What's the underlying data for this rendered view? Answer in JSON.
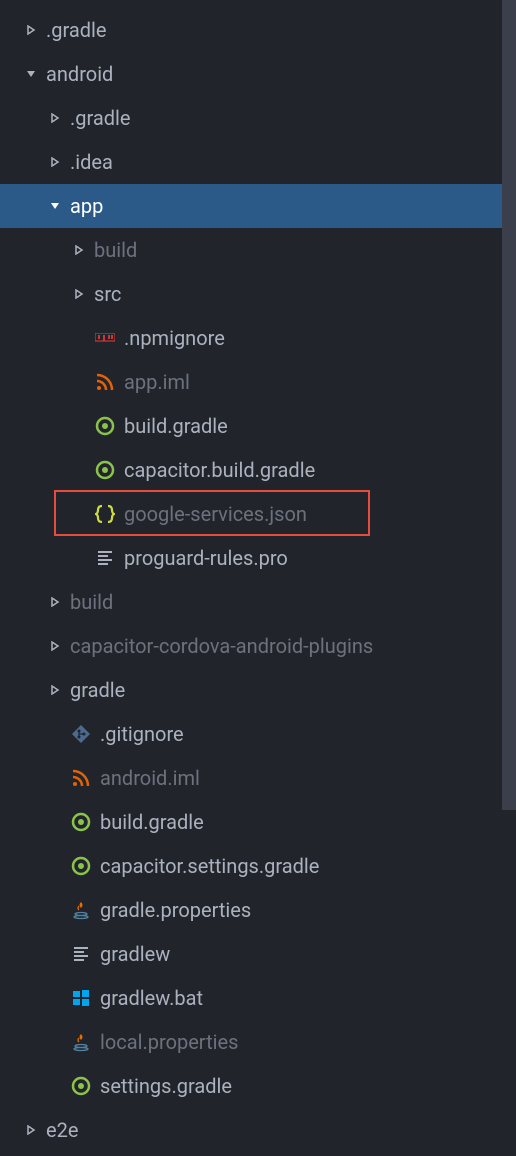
{
  "tree": {
    "items": [
      {
        "depth": 0,
        "chevron": "right",
        "icon": null,
        "label": ".gradle",
        "dimmed": false,
        "selected": false,
        "highlight": false
      },
      {
        "depth": 0,
        "chevron": "down",
        "icon": null,
        "label": "android",
        "dimmed": false,
        "selected": false,
        "highlight": false
      },
      {
        "depth": 1,
        "chevron": "right",
        "icon": null,
        "label": ".gradle",
        "dimmed": false,
        "selected": false,
        "highlight": false
      },
      {
        "depth": 1,
        "chevron": "right",
        "icon": null,
        "label": ".idea",
        "dimmed": false,
        "selected": false,
        "highlight": false
      },
      {
        "depth": 1,
        "chevron": "down",
        "icon": null,
        "label": "app",
        "dimmed": false,
        "selected": true,
        "highlight": false
      },
      {
        "depth": 2,
        "chevron": "right",
        "icon": null,
        "label": "build",
        "dimmed": true,
        "selected": false,
        "highlight": false
      },
      {
        "depth": 2,
        "chevron": "right",
        "icon": null,
        "label": "src",
        "dimmed": false,
        "selected": false,
        "highlight": false
      },
      {
        "depth": 2,
        "chevron": null,
        "icon": "npm",
        "label": ".npmignore",
        "dimmed": false,
        "selected": false,
        "highlight": false
      },
      {
        "depth": 2,
        "chevron": null,
        "icon": "rss",
        "label": "app.iml",
        "dimmed": true,
        "selected": false,
        "highlight": false
      },
      {
        "depth": 2,
        "chevron": null,
        "icon": "gradle",
        "label": "build.gradle",
        "dimmed": false,
        "selected": false,
        "highlight": false
      },
      {
        "depth": 2,
        "chevron": null,
        "icon": "gradle",
        "label": "capacitor.build.gradle",
        "dimmed": false,
        "selected": false,
        "highlight": false
      },
      {
        "depth": 2,
        "chevron": null,
        "icon": "json",
        "label": "google-services.json",
        "dimmed": true,
        "selected": false,
        "highlight": true
      },
      {
        "depth": 2,
        "chevron": null,
        "icon": "lines",
        "label": "proguard-rules.pro",
        "dimmed": false,
        "selected": false,
        "highlight": false
      },
      {
        "depth": 1,
        "chevron": "right",
        "icon": null,
        "label": "build",
        "dimmed": true,
        "selected": false,
        "highlight": false
      },
      {
        "depth": 1,
        "chevron": "right",
        "icon": null,
        "label": "capacitor-cordova-android-plugins",
        "dimmed": true,
        "selected": false,
        "highlight": false
      },
      {
        "depth": 1,
        "chevron": "right",
        "icon": null,
        "label": "gradle",
        "dimmed": false,
        "selected": false,
        "highlight": false
      },
      {
        "depth": 1,
        "chevron": null,
        "icon": "git",
        "label": ".gitignore",
        "dimmed": false,
        "selected": false,
        "highlight": false
      },
      {
        "depth": 1,
        "chevron": null,
        "icon": "rss",
        "label": "android.iml",
        "dimmed": true,
        "selected": false,
        "highlight": false
      },
      {
        "depth": 1,
        "chevron": null,
        "icon": "gradle",
        "label": "build.gradle",
        "dimmed": false,
        "selected": false,
        "highlight": false
      },
      {
        "depth": 1,
        "chevron": null,
        "icon": "gradle",
        "label": "capacitor.settings.gradle",
        "dimmed": false,
        "selected": false,
        "highlight": false
      },
      {
        "depth": 1,
        "chevron": null,
        "icon": "java",
        "label": "gradle.properties",
        "dimmed": false,
        "selected": false,
        "highlight": false
      },
      {
        "depth": 1,
        "chevron": null,
        "icon": "lines",
        "label": "gradlew",
        "dimmed": false,
        "selected": false,
        "highlight": false
      },
      {
        "depth": 1,
        "chevron": null,
        "icon": "windows",
        "label": "gradlew.bat",
        "dimmed": false,
        "selected": false,
        "highlight": false
      },
      {
        "depth": 1,
        "chevron": null,
        "icon": "java",
        "label": "local.properties",
        "dimmed": true,
        "selected": false,
        "highlight": false
      },
      {
        "depth": 1,
        "chevron": null,
        "icon": "gradle",
        "label": "settings.gradle",
        "dimmed": false,
        "selected": false,
        "highlight": false
      },
      {
        "depth": 0,
        "chevron": "right",
        "icon": null,
        "label": "e2e",
        "dimmed": false,
        "selected": false,
        "highlight": false
      }
    ]
  },
  "icons": {
    "npm": {
      "color": "#cb3837",
      "type": "npm"
    },
    "rss": {
      "color": "#e36209",
      "type": "rss"
    },
    "gradle": {
      "color": "#8bc34a",
      "type": "gradle"
    },
    "json": {
      "color": "#cddc39",
      "type": "json"
    },
    "lines": {
      "color": "#abb2bf",
      "type": "lines"
    },
    "git": {
      "color": "#4b6a8e",
      "type": "git"
    },
    "java": {
      "color": "#e76f00",
      "type": "java"
    },
    "windows": {
      "color": "#00a4ef",
      "type": "windows"
    }
  }
}
